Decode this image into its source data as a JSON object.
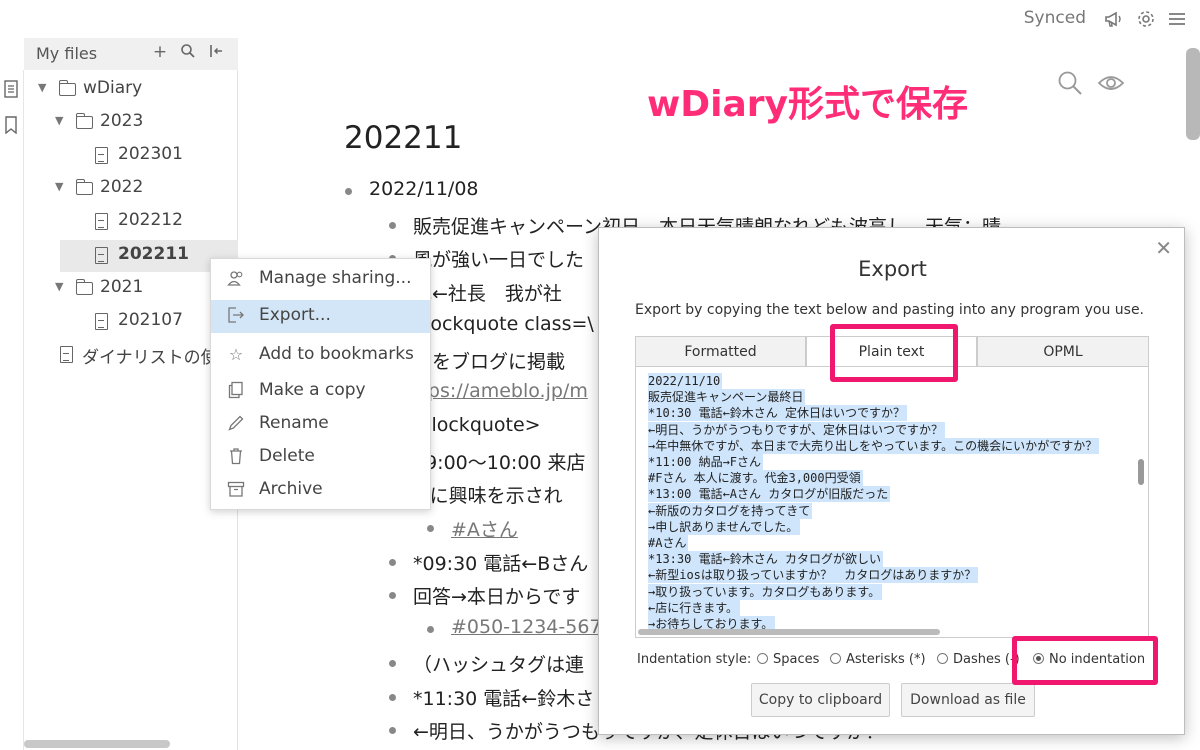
{
  "topbar": {
    "status": "Synced",
    "icons": [
      "megaphone-icon",
      "gear-icon",
      "menu-icon"
    ]
  },
  "sidebar": {
    "title": "My files",
    "tree": [
      {
        "label": "wDiary",
        "type": "folder",
        "level": 0
      },
      {
        "label": "2023",
        "type": "folder",
        "level": 1
      },
      {
        "label": "202301",
        "type": "document",
        "level": 2
      },
      {
        "label": "2022",
        "type": "folder",
        "level": 1
      },
      {
        "label": "202212",
        "type": "document",
        "level": 2
      },
      {
        "label": "202211",
        "type": "document",
        "level": 2,
        "selected": true
      },
      {
        "label": "2021",
        "type": "folder",
        "level": 1
      },
      {
        "label": "202107",
        "type": "document",
        "level": 2
      },
      {
        "label": "ダイナリストの使",
        "type": "document",
        "level": 0
      }
    ]
  },
  "context_menu": {
    "items": [
      {
        "label": "Manage sharing...",
        "icon": "people-icon"
      },
      {
        "label": "Export...",
        "icon": "export-icon",
        "active": true
      },
      {
        "label": "Add to bookmarks",
        "icon": "star-icon"
      },
      {
        "label": "Make a copy",
        "icon": "copy-icon"
      },
      {
        "label": "Rename",
        "icon": "pencil-icon"
      },
      {
        "label": "Delete",
        "icon": "trash-icon"
      },
      {
        "label": "Archive",
        "icon": "archive-icon"
      }
    ]
  },
  "editor": {
    "title": "202211",
    "overlay_caption": "wDiary形式で保存",
    "lines": [
      {
        "text": "2022/11/08",
        "level": 0
      },
      {
        "text": "販売促進キャンペーン初日。本日天気晴朗なれども波高し、天気：晴",
        "level": 1
      },
      {
        "text": "風が強い一日でした",
        "level": 1
      },
      {
        "text": "礼←社長　我が社",
        "level": 1
      },
      {
        "text": "blockquote class=\\",
        "level": 1
      },
      {
        "text": "明をブログに掲載",
        "level": 1
      },
      {
        "text": "ttps://ameblo.jp/m",
        "level": 1,
        "link": true
      },
      {
        "text": "/blockquote>",
        "level": 1
      },
      {
        "text": "09:00〜10:00 来店",
        "level": 1
      },
      {
        "text": "○に興味を示され",
        "level": 1
      },
      {
        "text": "#Aさん",
        "level": 2,
        "link": true
      },
      {
        "text": "*09:30 電話←Bさん",
        "level": 1
      },
      {
        "text": "回答→本日からです",
        "level": 1
      },
      {
        "text": "#050-1234-5678",
        "level": 2,
        "link": true
      },
      {
        "text": "（ハッシュタグは連",
        "level": 1
      },
      {
        "text": "*11:30 電話←鈴木さ",
        "level": 1
      },
      {
        "text": "←明日、うかがうつもりですが、定休日はいつですか？",
        "level": 1
      }
    ]
  },
  "export_dialog": {
    "title": "Export",
    "description": "Export by copying the text below and pasting into any program you use.",
    "tabs": [
      {
        "label": "Formatted"
      },
      {
        "label": "Plain text",
        "selected": true
      },
      {
        "label": "OPML"
      }
    ],
    "text_lines": [
      "2022/11/10",
      "販売促進キャンペーン最終日",
      "*10:30 電話←鈴木さん 定休日はいつですか？",
      "←明日、うかがうつもりですが、定休日はいつですか？",
      "→年中無休ですが、本日まで大売り出しをやっています。この機会にいかがですか？",
      "*11:00 納品→Fさん",
      "#Fさん 本人に渡す。代金3,000円受領",
      "*13:00 電話←Aさん カタログが旧版だった",
      "←新版のカタログを持ってきて",
      "→申し訳ありませんでした。",
      "#Aさん",
      "*13:30 電話←鈴木さん カタログが欲しい",
      "←新型iosは取り扱っていますか？　カタログはありますか？",
      "→取り扱っています。カタログもあります。",
      "←店に行きます。",
      "→お待ちしております。"
    ],
    "indentation_label": "Indentation style:",
    "indentation_options": [
      {
        "label": "Spaces",
        "checked": false
      },
      {
        "label": "Asterisks (*)",
        "checked": false
      },
      {
        "label": "Dashes (-)",
        "checked": false
      },
      {
        "label": "No indentation",
        "checked": true
      }
    ],
    "buttons": {
      "copy": "Copy to clipboard",
      "download": "Download as file"
    },
    "highlight_color": "#f0186e"
  }
}
